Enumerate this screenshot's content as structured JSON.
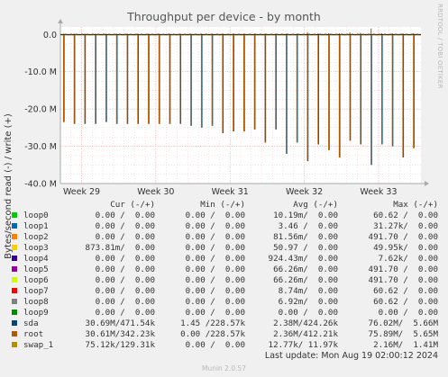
{
  "chart_data": {
    "type": "line",
    "title": "Throughput per device - by month",
    "ylabel": "Bytes/second read (-) / write (+)",
    "xlabel": "",
    "ylim": [
      -40,
      2
    ],
    "y_unit": "M",
    "y_ticks": [
      0,
      -10,
      -20,
      -30,
      -40
    ],
    "y_tick_labels": [
      "0.0",
      "-10.0 M",
      "-20.0 M",
      "-30.0 M",
      "-40.0 M"
    ],
    "x_tick_labels": [
      "Week 29",
      "Week 30",
      "Week 31",
      "Week 32",
      "Week 33"
    ],
    "x_range_days": [
      0,
      34
    ],
    "x_ticks_day": [
      2,
      9,
      16,
      23,
      30
    ],
    "grid": true,
    "series_spike_days": [
      0.3,
      1.3,
      2.3,
      3.3,
      4.3,
      5.3,
      6.3,
      7.3,
      8.3,
      9.3,
      10.3,
      11.3,
      12.3,
      13.3,
      14.3,
      15.3,
      16.3,
      17.3,
      18.3,
      19.3,
      20.3,
      21.3,
      22.3,
      23.3,
      24.3,
      25.3,
      26.3,
      27.3,
      28.3,
      29.3,
      30.3,
      31.3,
      32.3,
      33.3
    ],
    "series_spike_read_M": [
      -23.5,
      -24,
      -24,
      -24,
      -23.5,
      -24,
      -24,
      -24,
      -24,
      -24,
      -24,
      -24,
      -24.5,
      -25,
      -24.5,
      -26.5,
      -26,
      -26,
      -25.5,
      -29,
      -25.5,
      -32,
      -29,
      -34,
      -29.5,
      -31,
      -33,
      -28.5,
      -29.5,
      -35,
      -29.5,
      -30,
      -33,
      -30.5
    ],
    "series_spike_write_M": [
      0.2,
      0.2,
      0.2,
      0.2,
      0.2,
      0.2,
      0.2,
      0.2,
      0.2,
      0.2,
      0.2,
      0.2,
      0.2,
      0.2,
      0.2,
      0.2,
      0.2,
      0.2,
      0.2,
      0.2,
      0.2,
      0.2,
      0.2,
      0.6,
      0.3,
      0.3,
      0.3,
      0.5,
      0.4,
      1.6,
      0.3,
      0.3,
      0.3,
      0.3
    ],
    "columns": [
      "Cur (-/+)",
      "Min (-/+)",
      "Avg (-/+)",
      "Max (-/+)"
    ],
    "series": [
      {
        "name": "loop0",
        "color": "#00cc00",
        "cur": "0.00 /  0.00",
        "min": "0.00 /  0.00",
        "avg": "10.19m/  0.00",
        "max": "60.62 /  0.00"
      },
      {
        "name": "loop1",
        "color": "#0066b3",
        "cur": "0.00 /  0.00",
        "min": "0.00 /  0.00",
        "avg": "3.46 /  0.00",
        "max": "31.27k/  0.00"
      },
      {
        "name": "loop2",
        "color": "#ff8000",
        "cur": "0.00 /  0.00",
        "min": "0.00 /  0.00",
        "avg": "81.56m/  0.00",
        "max": "491.70 /  0.00"
      },
      {
        "name": "loop3",
        "color": "#ffcc00",
        "cur": "873.81m/  0.00",
        "min": "0.00 /  0.00",
        "avg": "50.97 /  0.00",
        "max": "49.95k/  0.00"
      },
      {
        "name": "loop4",
        "color": "#330099",
        "cur": "0.00 /  0.00",
        "min": "0.00 /  0.00",
        "avg": "924.43m/  0.00",
        "max": "7.62k/  0.00"
      },
      {
        "name": "loop5",
        "color": "#990099",
        "cur": "0.00 /  0.00",
        "min": "0.00 /  0.00",
        "avg": "66.26m/  0.00",
        "max": "491.70 /  0.00"
      },
      {
        "name": "loop6",
        "color": "#ccff00",
        "cur": "0.00 /  0.00",
        "min": "0.00 /  0.00",
        "avg": "66.26m/  0.00",
        "max": "491.70 /  0.00"
      },
      {
        "name": "loop7",
        "color": "#ff0000",
        "cur": "0.00 /  0.00",
        "min": "0.00 /  0.00",
        "avg": "8.74m/  0.00",
        "max": "60.62 /  0.00"
      },
      {
        "name": "loop8",
        "color": "#808080",
        "cur": "0.00 /  0.00",
        "min": "0.00 /  0.00",
        "avg": "6.92m/  0.00",
        "max": "60.62 /  0.00"
      },
      {
        "name": "loop9",
        "color": "#008f00",
        "cur": "0.00 /  0.00",
        "min": "0.00 /  0.00",
        "avg": "0.00 /  0.00",
        "max": "0.00 /  0.00"
      },
      {
        "name": "sda",
        "color": "#00487d",
        "cur": "30.69M/471.54k",
        "min": "1.45 /228.57k",
        "avg": "2.38M/424.26k",
        "max": "76.02M/  5.66M"
      },
      {
        "name": "root",
        "color": "#b35a00",
        "cur": "30.61M/342.23k",
        "min": "0.00 /228.57k",
        "avg": "2.36M/412.21k",
        "max": "75.89M/  5.65M"
      },
      {
        "name": "swap_1",
        "color": "#b38f00",
        "cur": "75.12k/129.31k",
        "min": "0.00 /  0.00",
        "avg": "12.77k/ 11.97k",
        "max": "2.16M/  1.41M"
      }
    ]
  },
  "side_credit": "RRDTOOL / TOBI OETIKER",
  "last_update": "Last update: Mon Aug 19 02:00:12 2024",
  "munin_version": "Munin 2.0.57"
}
